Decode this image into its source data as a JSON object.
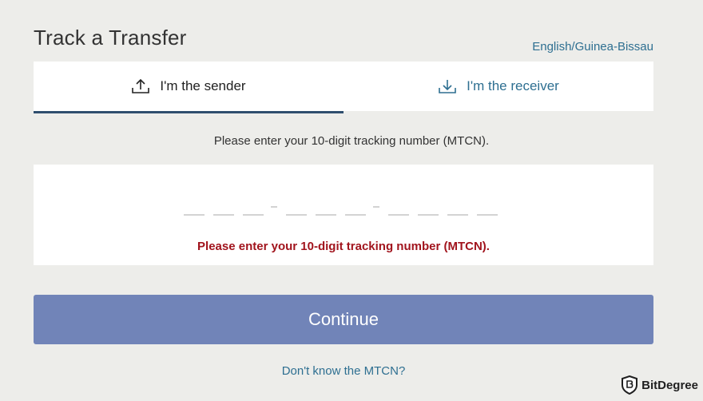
{
  "page": {
    "title": "Track a Transfer",
    "language_link": "English/Guinea-Bissau"
  },
  "tabs": [
    {
      "label": "I'm the sender",
      "icon": "upload-icon",
      "active": true
    },
    {
      "label": "I'm the receiver",
      "icon": "download-icon",
      "active": false
    }
  ],
  "form": {
    "instruction": "Please enter your 10-digit tracking number (MTCN).",
    "mtcn_value": "",
    "mtcn_format": "___-___-____",
    "error_message": "Please enter your 10-digit tracking number (MTCN).",
    "continue_label": "Continue",
    "help_link": "Don't know the MTCN?"
  },
  "watermark": {
    "text": "BitDegree"
  },
  "colors": {
    "background": "#ededea",
    "active_tab_underline": "#2f4e6e",
    "link": "#2e6f91",
    "error": "#a1141d",
    "button": "#7184b8"
  }
}
